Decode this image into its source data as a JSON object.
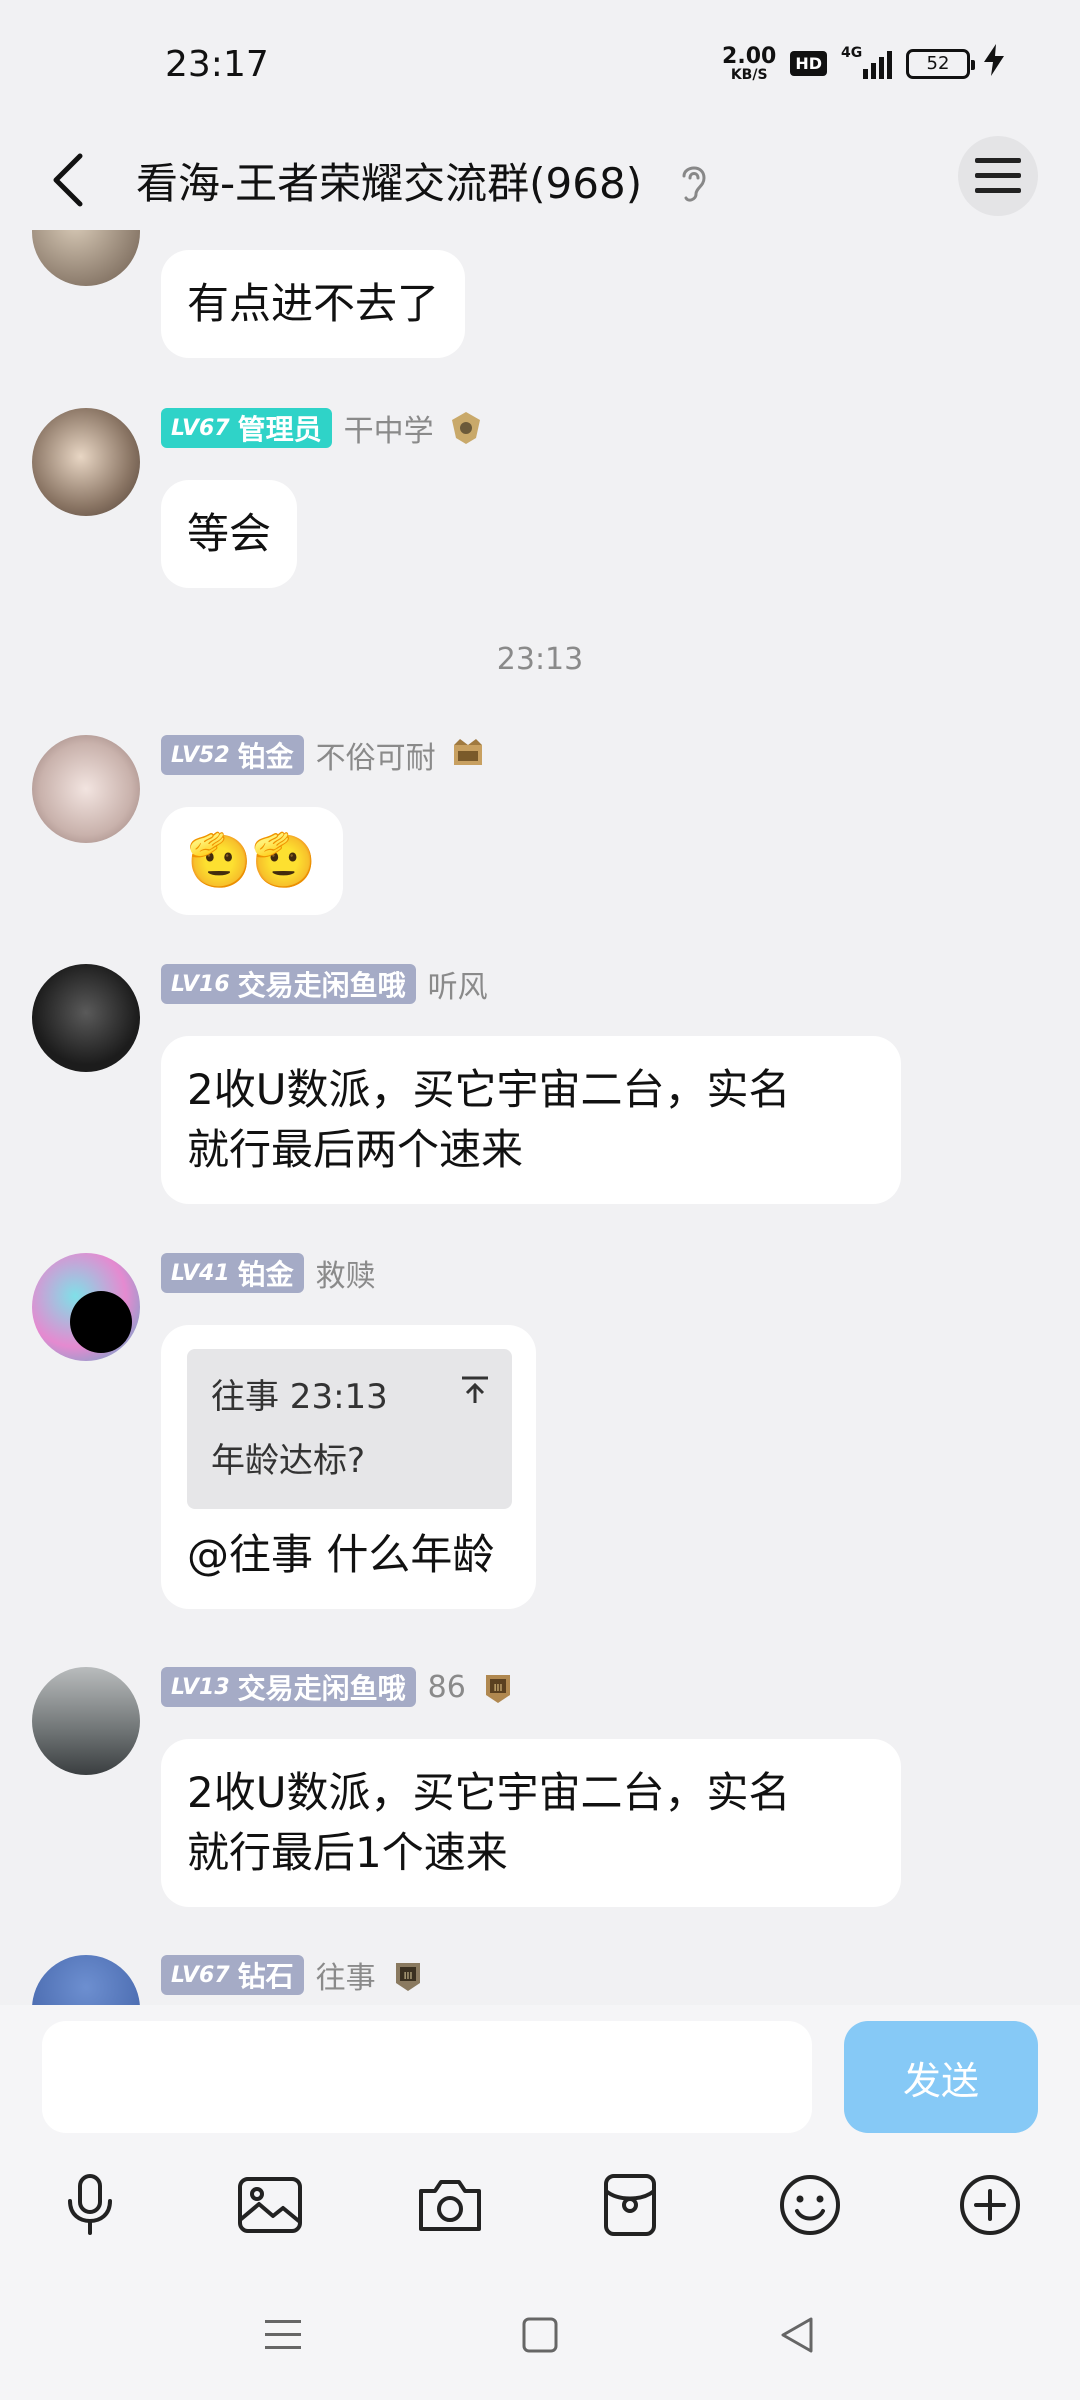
{
  "status_bar": {
    "time": "23:17",
    "net_speed": "2.00",
    "net_unit": "KB/S",
    "hd": "HD",
    "network": "4G",
    "battery": "52"
  },
  "header": {
    "title": "看海-王者荣耀交流群(968)"
  },
  "messages": [
    {
      "text": "有点进不去了"
    },
    {
      "badge_level": "LV67",
      "badge_title": "管理员",
      "sender": "干中学",
      "text": "等会"
    },
    {
      "badge_level": "LV52",
      "badge_title": "铂金",
      "sender": "不俗可耐",
      "text": "🫡🫡"
    },
    {
      "badge_level": "LV16",
      "badge_title": "交易走闲鱼哦",
      "sender": "听风",
      "line1": "2收U数派，买它宇宙二台，实名",
      "line2": "就行最后两个速来"
    },
    {
      "badge_level": "LV41",
      "badge_title": "铂金",
      "sender": "救赎",
      "quote_header": "往事 23:13",
      "quote_text": "年龄达标?",
      "text": "@往事 什么年龄"
    },
    {
      "badge_level": "LV13",
      "badge_title": "交易走闲鱼哦",
      "sender": "86",
      "line1": "2收U数派，买它宇宙二台，实名",
      "line2": "就行最后1个速来"
    },
    {
      "badge_level": "LV67",
      "badge_title": "钻石",
      "sender": "往事"
    }
  ],
  "time_separator": "23:13",
  "input": {
    "placeholder": "",
    "send_label": "发送"
  },
  "colors": {
    "admin_badge": "#2fd3c8",
    "rank_badge": "#a5abc6",
    "send_button": "#86c9f6",
    "background": "#f1f1f3"
  },
  "icons": {
    "toolbar": [
      "microphone-icon",
      "image-icon",
      "camera-icon",
      "red-packet-icon",
      "emoji-icon",
      "plus-icon"
    ],
    "nav": [
      "menu-icon",
      "home-square-icon",
      "back-triangle-icon"
    ]
  }
}
